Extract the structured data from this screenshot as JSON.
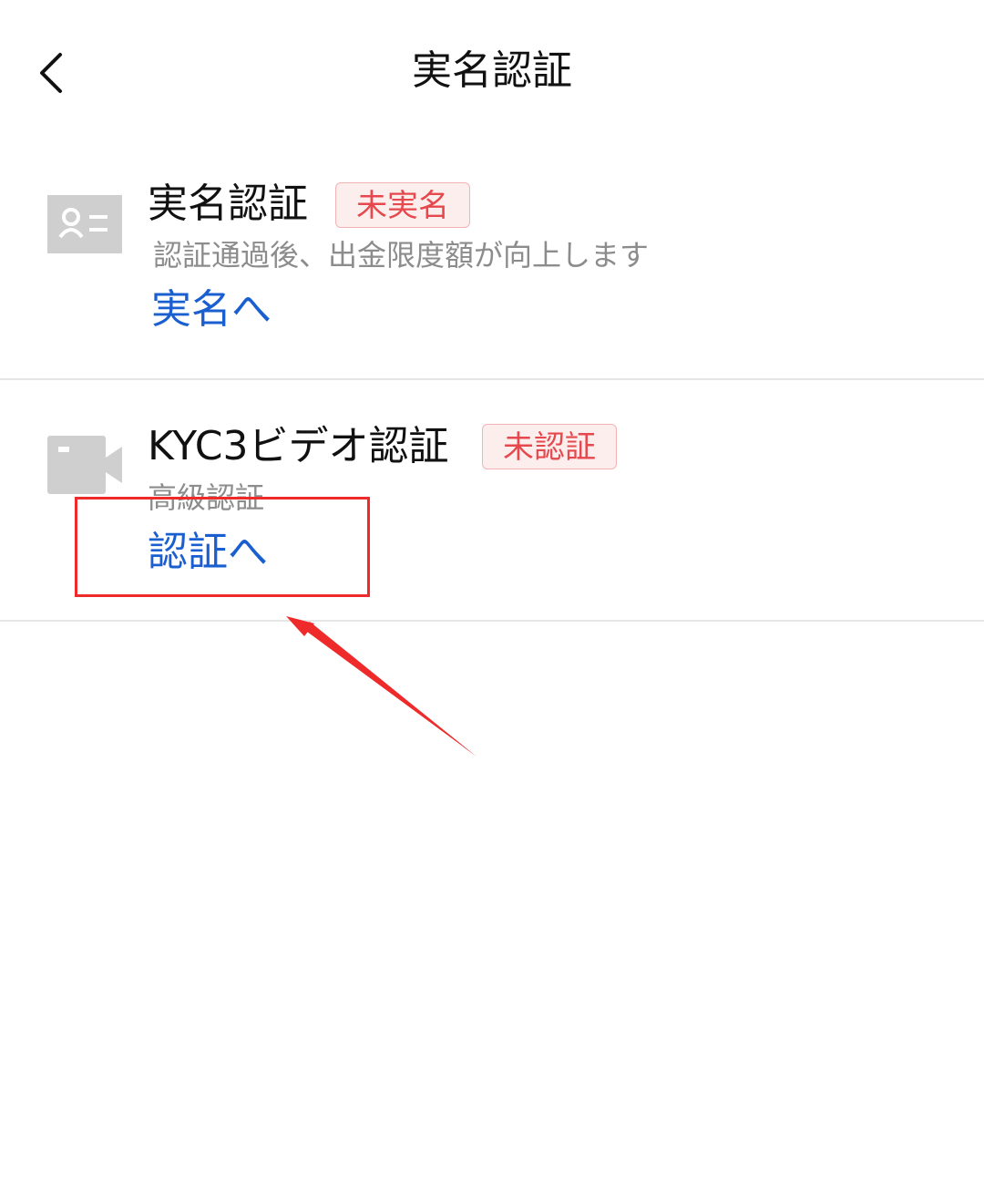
{
  "header": {
    "title": "実名認証"
  },
  "items": [
    {
      "icon": "id-card-icon",
      "title": "実名認証",
      "badge": "未実名",
      "subtitle": "認証通過後、出金限度額が向上します",
      "action": "実名へ"
    },
    {
      "icon": "video-camera-icon",
      "title": "KYC3ビデオ認証",
      "badge": "未認証",
      "subtitle": "高級認証",
      "action": "認証へ"
    }
  ],
  "colors": {
    "link": "#1a5fd0",
    "badge_text": "#e5484d",
    "badge_bg": "#fdeeee",
    "annotation": "#ee2a2a",
    "icon_gray": "#cfcfcf"
  }
}
